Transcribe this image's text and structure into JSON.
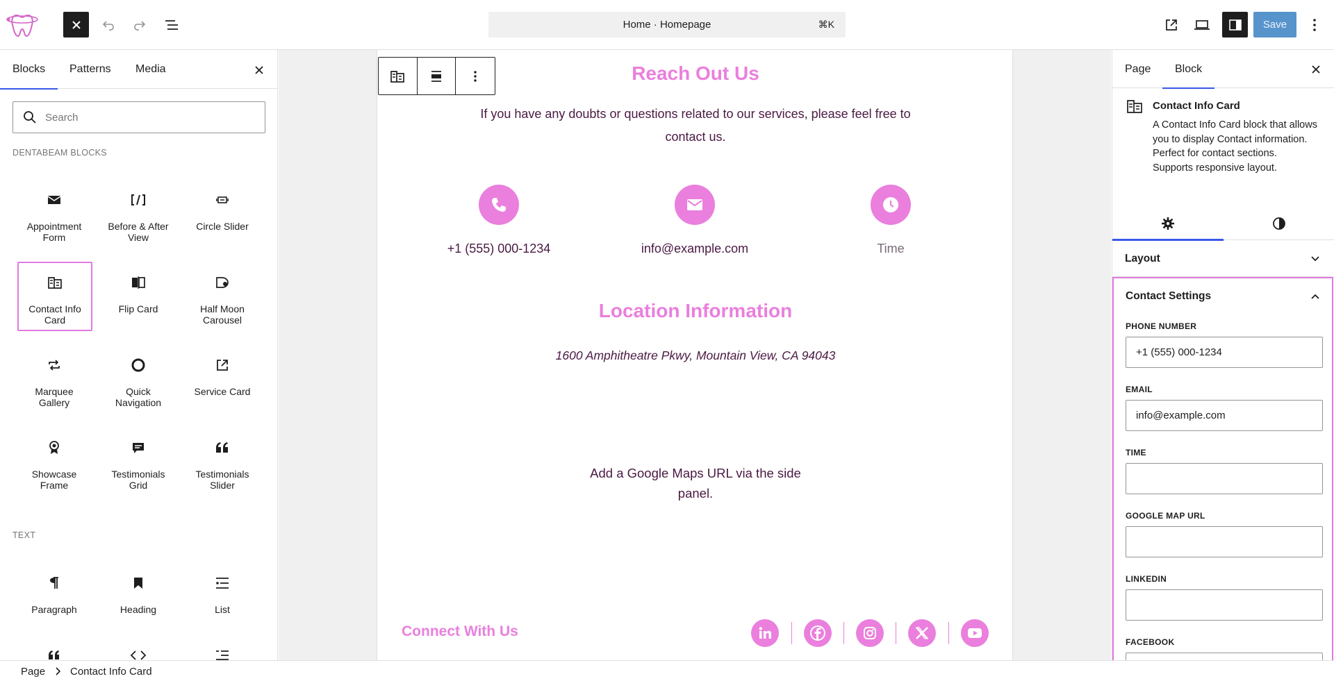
{
  "topbar": {
    "command_text": "Home · Homepage",
    "shortcut": "⌘K",
    "save_label": "Save"
  },
  "inserter": {
    "tabs": [
      "Blocks",
      "Patterns",
      "Media"
    ],
    "search_placeholder": "Search",
    "categories": {
      "dentabeam": "DENTABEAM BLOCKS",
      "text": "TEXT"
    },
    "dentabeam_blocks": [
      {
        "label": "Appointment Form",
        "icon": "envelope-icon"
      },
      {
        "label": "Before & After View",
        "icon": "compare-icon"
      },
      {
        "label": "Circle Slider",
        "icon": "slider-icon"
      },
      {
        "label": "Contact Info Card",
        "icon": "contact-card-icon"
      },
      {
        "label": "Flip Card",
        "icon": "flip-icon"
      },
      {
        "label": "Half Moon Carousel",
        "icon": "half-moon-icon"
      },
      {
        "label": "Marquee Gallery",
        "icon": "loop-icon"
      },
      {
        "label": "Quick Navigation",
        "icon": "circle-icon"
      },
      {
        "label": "Service Card",
        "icon": "external-link-icon"
      },
      {
        "label": "Showcase Frame",
        "icon": "award-icon"
      },
      {
        "label": "Testimonials Grid",
        "icon": "comment-icon"
      },
      {
        "label": "Testimonials Slider",
        "icon": "quote-icon"
      }
    ],
    "text_blocks": [
      {
        "label": "Paragraph",
        "icon": "paragraph-icon"
      },
      {
        "label": "Heading",
        "icon": "bookmark-icon"
      },
      {
        "label": "List",
        "icon": "list-icon"
      }
    ]
  },
  "canvas": {
    "reach_heading": "Reach Out Us",
    "reach_text": "If you have any doubts or questions related to our services, please feel free to contact us.",
    "phone": "+1 (555) 000-1234",
    "email": "info@example.com",
    "time": "Time",
    "location_heading": "Location Information",
    "address": "1600 Amphitheatre Pkwy, Mountain View, CA 94043",
    "maps_hint": "Add a Google Maps URL via the side panel.",
    "connect_heading": "Connect With Us",
    "social_icons": [
      "linkedin-icon",
      "facebook-icon",
      "instagram-icon",
      "x-icon",
      "youtube-icon"
    ],
    "accent_color": "#ea7fdd"
  },
  "sidebar": {
    "tabs": [
      "Page",
      "Block"
    ],
    "block_title": "Contact Info Card",
    "block_description": "A Contact Info Card block that allows you to display Contact information. Perfect for contact sections. Supports responsive layout.",
    "layout_label": "Layout",
    "contact_settings_label": "Contact Settings",
    "fields": [
      {
        "label": "PHONE NUMBER",
        "value": "+1 (555) 000-1234"
      },
      {
        "label": "EMAIL",
        "value": "info@example.com"
      },
      {
        "label": "TIME",
        "value": ""
      },
      {
        "label": "GOOGLE MAP URL",
        "value": ""
      },
      {
        "label": "LINKEDIN",
        "value": ""
      },
      {
        "label": "FACEBOOK",
        "value": ""
      }
    ]
  },
  "breadcrumb": {
    "items": [
      "Page",
      "Contact Info Card"
    ]
  }
}
